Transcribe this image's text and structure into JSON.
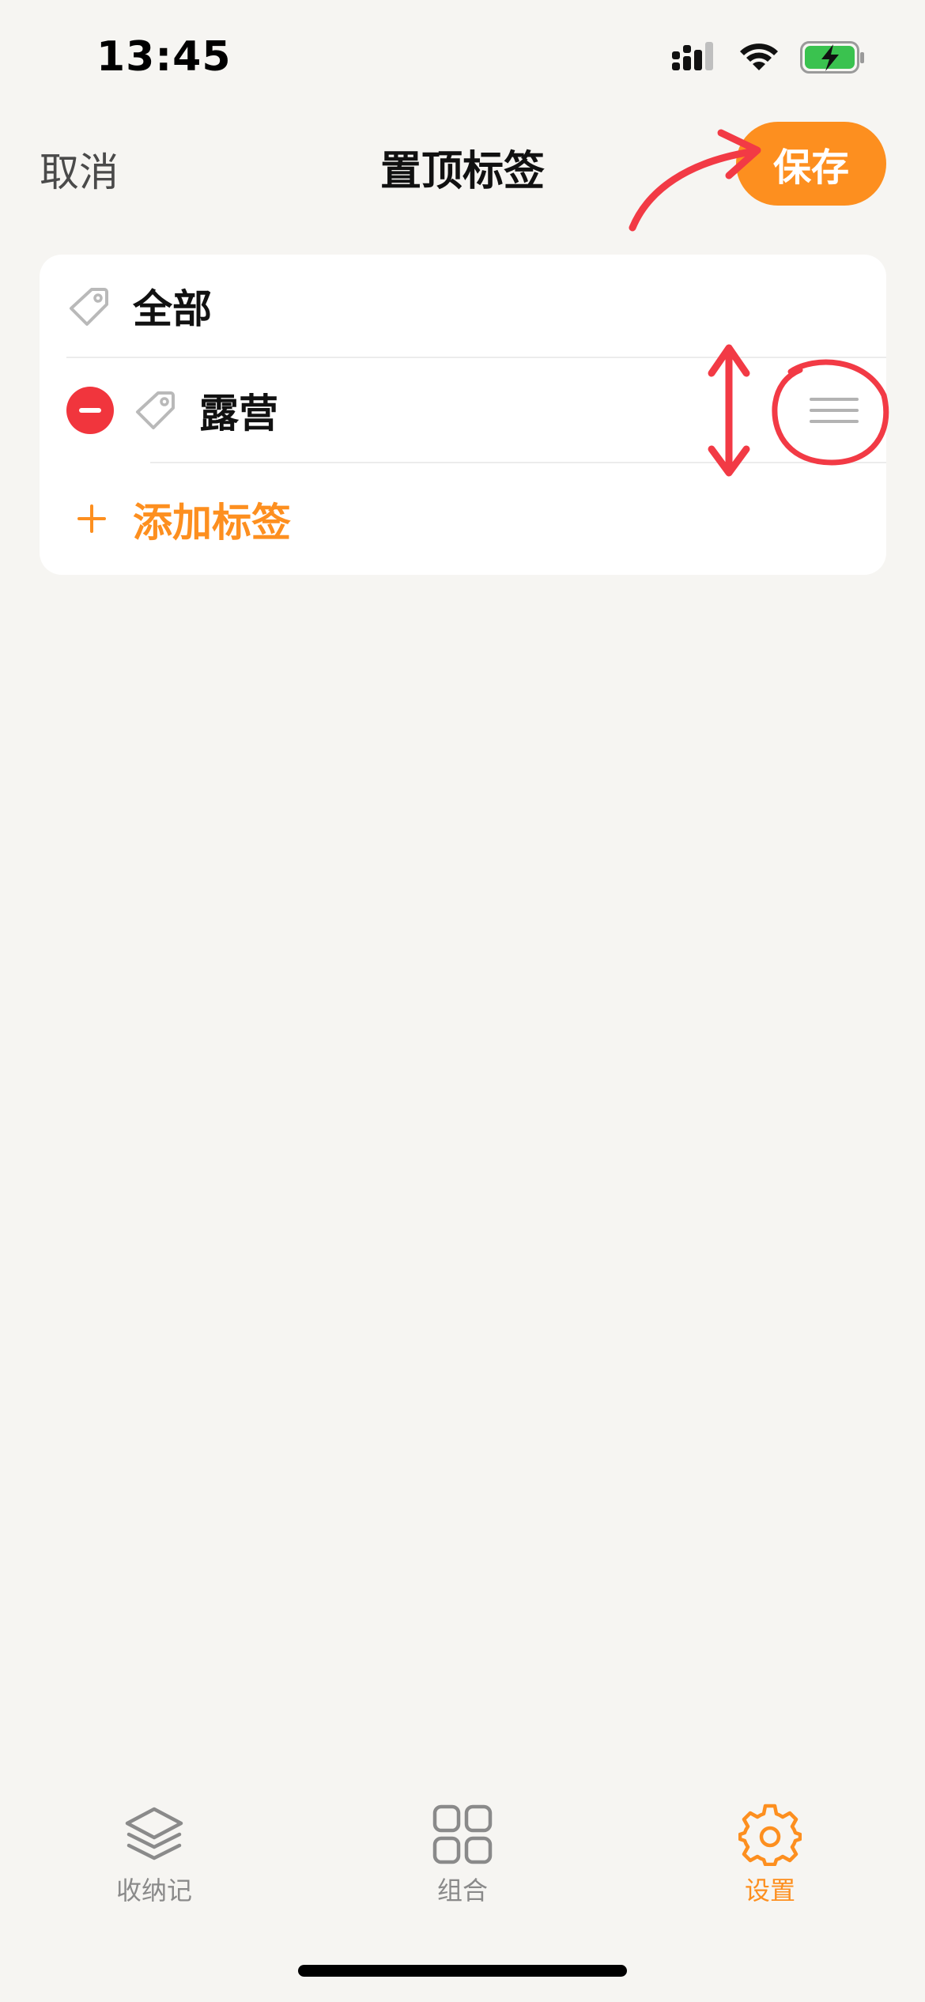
{
  "status_bar": {
    "time": "13:45"
  },
  "nav": {
    "cancel_label": "取消",
    "title": "置顶标签",
    "save_label": "保存"
  },
  "tags": {
    "items": [
      {
        "label": "全部",
        "icon": "tag-icon",
        "removable": false
      },
      {
        "label": "露营",
        "icon": "tag-icon",
        "removable": true
      }
    ],
    "add_label": "添加标签"
  },
  "tab_bar": {
    "items": [
      {
        "label": "收纳记",
        "icon": "stack-icon",
        "active": false
      },
      {
        "label": "组合",
        "icon": "grid-icon",
        "active": false
      },
      {
        "label": "设置",
        "icon": "gear-icon",
        "active": true
      }
    ]
  },
  "colors": {
    "accent": "#fd8f1f",
    "delete": "#f1353d",
    "annotation": "#f23a45",
    "background": "#f6f5f2"
  }
}
